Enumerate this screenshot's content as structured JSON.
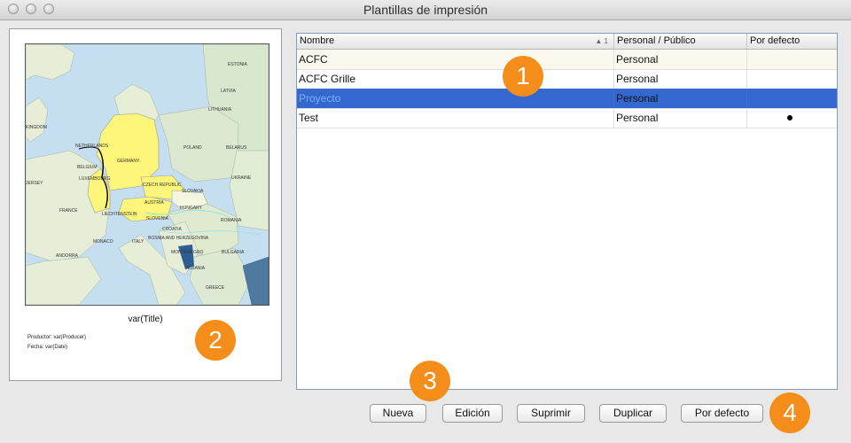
{
  "window": {
    "title": "Plantillas de impresión"
  },
  "preview": {
    "map_labels": {
      "estonia": "ESTONIA",
      "latvia": "LATVIA",
      "lithuania": "LITHUANIA",
      "kingdom": "KINGDOM",
      "netherlands": "NETHERLANDS",
      "belgium": "BELGIUM",
      "luxembourg": "LUXEMBOURG",
      "germany": "GERMANY",
      "poland": "POLAND",
      "belarus": "BELARUS",
      "czech": "CZECH REPUBLIC",
      "slovakia": "SLOVAKIA",
      "ukraine": "UKRAINE",
      "jersey": "JERSEY",
      "france": "FRANCE",
      "liechtenstein": "LIECHTENSTEIN",
      "austria": "AUSTRIA",
      "hungary": "HUNGARY",
      "slovenia": "SLOVENIA",
      "romania": "ROMANIA",
      "croatia": "CROATIA",
      "bosnia": "BOSNIA AND HERZEGOVINA",
      "monaco": "MONACO",
      "italy": "ITALY",
      "montenegro": "MONTENEGRO",
      "bulgaria": "BULGARIA",
      "andorra": "ANDORRA",
      "albania": "ALBANIA",
      "greece": "GREECE"
    },
    "title": "var(Title)",
    "producer_line": "Productor: var(Producer)",
    "date_line": "Fecha:  var(Date)"
  },
  "table": {
    "columns": [
      {
        "label": "Nombre",
        "sort": "▲ 1"
      },
      {
        "label": "Personal / Público"
      },
      {
        "label": "Por defecto"
      }
    ],
    "rows": [
      {
        "name": "ACFC",
        "scope": "Personal",
        "is_default": false
      },
      {
        "name": "ACFC Grille",
        "scope": "Personal",
        "is_default": false
      },
      {
        "name": "Proyecto",
        "scope": "Personal",
        "is_default": false,
        "selected": true
      },
      {
        "name": "Test",
        "scope": "Personal",
        "is_default": true
      }
    ]
  },
  "buttons": {
    "new": "Nueva",
    "edit": "Edición",
    "delete": "Suprimir",
    "duplicate": "Duplicar",
    "default": "Por defecto"
  },
  "callouts": [
    "1",
    "2",
    "3",
    "4"
  ],
  "colors": {
    "selection": "#3468cf",
    "callout": "#f58d1a",
    "highlighted_country": "#fdf67a"
  }
}
